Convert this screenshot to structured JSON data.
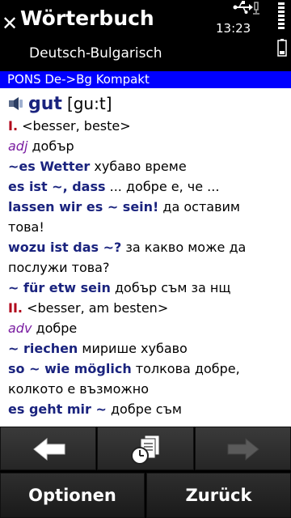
{
  "header": {
    "title": "Wörterbuch",
    "subtitle": "Deutsch-Bulgarisch",
    "time": "13:23",
    "close_glyph": "✕"
  },
  "dict_bar": {
    "label": "PONS De->Bg Kompakt"
  },
  "entry": {
    "headword": "gut",
    "phonetic": "[gu:t]",
    "lines": [
      {
        "roman": "I.",
        "text": " <besser, beste>"
      },
      {
        "pos": "adj",
        "bg": " добър"
      },
      {
        "de": "~es Wetter",
        "bg": " хубаво време"
      },
      {
        "de": "es ist ~, dass",
        "bg": " ... добре е, че ..."
      },
      {
        "de": "lassen wir es ~ sein!",
        "bg": " да оставим"
      },
      {
        "bg": "това!"
      },
      {
        "de": "wozu ist das ~?",
        "bg": " за какво може да"
      },
      {
        "bg": "послужи това?"
      },
      {
        "de": "~ für etw sein",
        "bg": " добър съм за нщ"
      },
      {
        "roman": "II.",
        "text": " <besser, am besten>"
      },
      {
        "pos": "adv",
        "bg": " добре"
      },
      {
        "de": "~ riechen",
        "bg": " мирише хубаво"
      },
      {
        "de": "so ~ wie möglich",
        "bg": " толкова добре,"
      },
      {
        "bg": "колкото е възможно"
      },
      {
        "de": "es geht mir ~",
        "bg": " добре съм"
      }
    ]
  },
  "softkeys": {
    "left": "Optionen",
    "right": "Zurück"
  },
  "colors": {
    "dict_bar": "#0000ff",
    "headword": "#1a237e",
    "roman": "#b0001a",
    "pos": "#7b1fa2"
  }
}
